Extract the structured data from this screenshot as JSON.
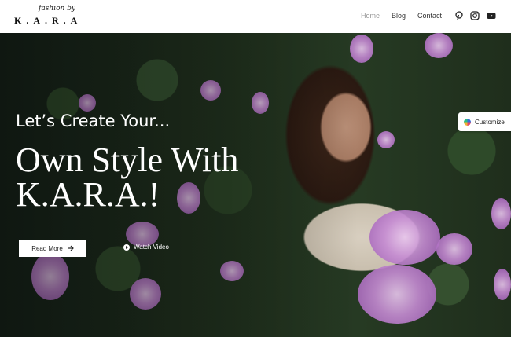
{
  "header": {
    "logo": {
      "script": "fashion by",
      "main": "K.A.R.A"
    },
    "nav": [
      {
        "label": "Home",
        "active": true
      },
      {
        "label": "Blog",
        "active": false
      },
      {
        "label": "Contact",
        "active": false
      }
    ],
    "social_icons": [
      "pinterest-icon",
      "instagram-icon",
      "youtube-icon"
    ]
  },
  "hero": {
    "subtitle": "Let’s Create Your...",
    "title": "Own Style With K.A.R.A.!",
    "read_more_label": "Read More",
    "watch_video_label": "Watch Video"
  },
  "customize": {
    "label": "Customize"
  },
  "colors": {
    "accent_text": "#ffffff",
    "header_bg": "#ffffff",
    "nav_active": "#999999"
  }
}
